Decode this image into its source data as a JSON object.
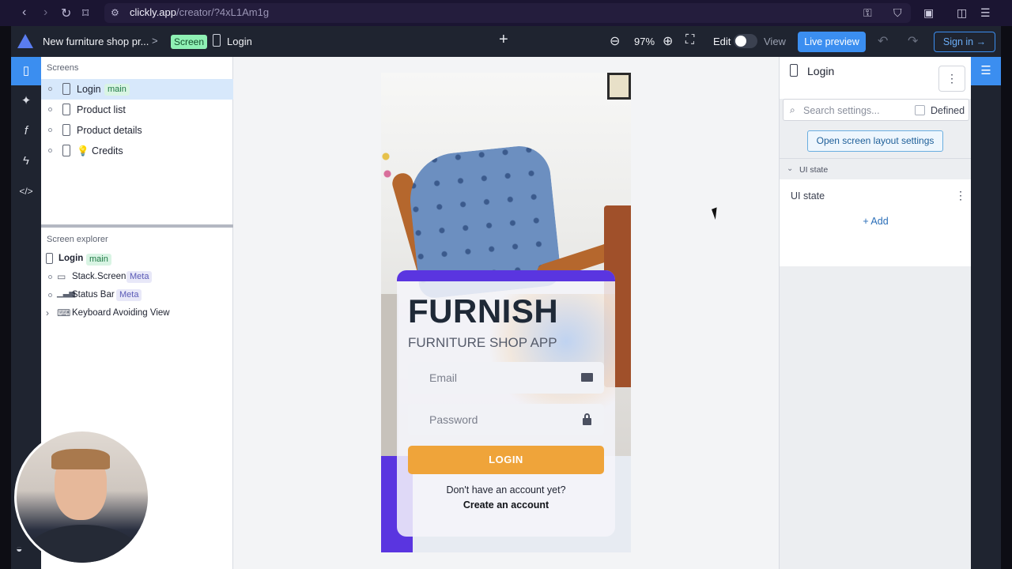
{
  "browser": {
    "url_host": "clickly.app",
    "url_path": "/creator/?4xL1Am1g"
  },
  "topbar": {
    "project": "New furniture shop pr...",
    "crumb_sep": ">",
    "screen_badge": "Screen",
    "crumb_screen": "Login",
    "add": "+",
    "zoom": "97%",
    "edit_label": "Edit",
    "view_label": "View",
    "live_preview": "Live preview",
    "signin": "Sign in →"
  },
  "screens": {
    "title": "Screens",
    "items": [
      {
        "label": "Login",
        "tag": "main"
      },
      {
        "label": "Product list"
      },
      {
        "label": "Product details"
      },
      {
        "label": "💡 Credits"
      }
    ]
  },
  "explorer": {
    "title": "Screen explorer",
    "root": {
      "label": "Login",
      "tag": "main"
    },
    "items": [
      {
        "label": "Stack.Screen",
        "tag": "Meta"
      },
      {
        "label": "Status Bar",
        "tag": "Meta"
      },
      {
        "label": "Keyboard Avoiding View"
      }
    ]
  },
  "app": {
    "brand": "FURNISH",
    "tagline": "FURNITURE SHOP APP",
    "email_placeholder": "Email",
    "password_placeholder": "Password",
    "login_button": "LOGIN",
    "no_account": "Don't have an account yet?",
    "create_account": "Create an account",
    "colors": {
      "primary": "#5a35e0",
      "accent": "#efa43a"
    }
  },
  "settings": {
    "title": "Login",
    "search_placeholder": "Search settings...",
    "defined_label": "Defined",
    "layout_button": "Open screen layout settings",
    "section_label": "UI state",
    "row_label": "UI state",
    "add_label": "+ Add"
  },
  "icons": {
    "rail_left": [
      "phone-icon",
      "component-icon",
      "function-icon",
      "lightning-icon",
      "code-icon"
    ],
    "rail_right": [
      "sliders-icon"
    ]
  }
}
